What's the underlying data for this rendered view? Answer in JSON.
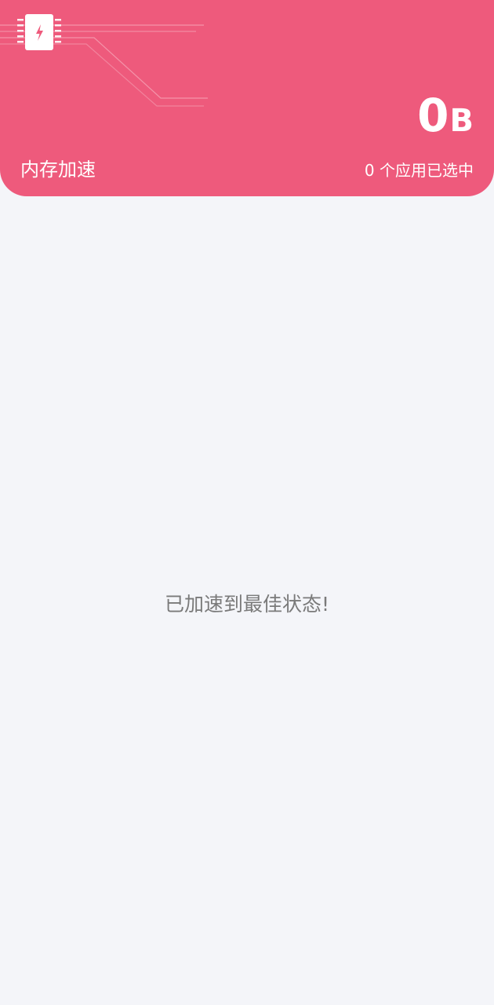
{
  "header": {
    "title": "内存加速",
    "size_value": "0",
    "size_unit": "B",
    "selected_count": "0 个应用已选中",
    "icon": "memory-chip-bolt-icon",
    "background_color": "#ee5a7c"
  },
  "main": {
    "empty_message": "已加速到最佳状态!"
  }
}
